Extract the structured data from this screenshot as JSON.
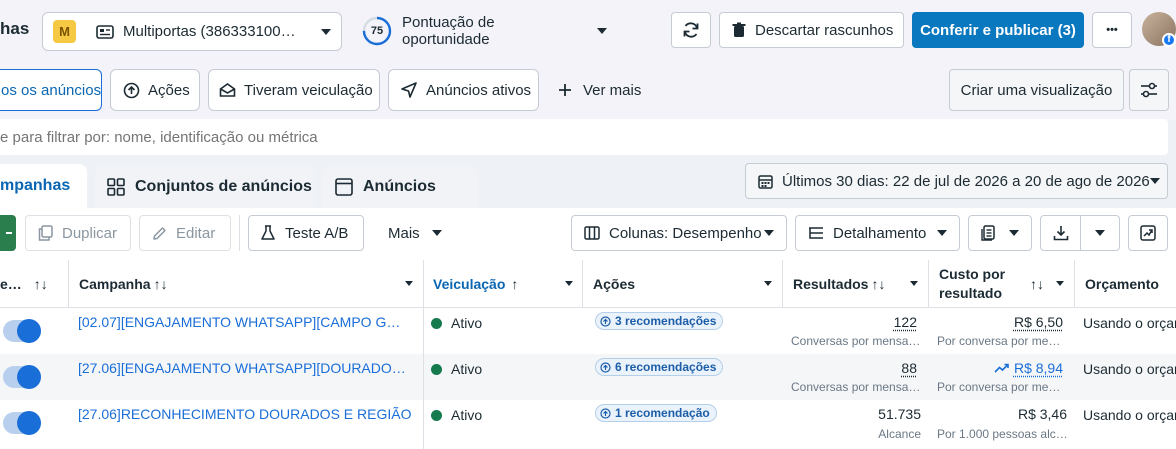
{
  "header": {
    "title_partial": "has",
    "account_badge": "M",
    "account_name": "Multiportas (386333100…",
    "opportunity_score": "75",
    "opportunity_label": "Pontuação de oportunidade",
    "discard_label": "Descartar rascunhos",
    "publish_label": "Conferir e publicar (3)",
    "more_label": "•••"
  },
  "filters": {
    "items": [
      {
        "label": "os os anúncios",
        "icon": "none"
      },
      {
        "label": "Ações",
        "icon": "arrow-up-circle-icon"
      },
      {
        "label": "Tiveram veiculação",
        "icon": "envelope-icon"
      },
      {
        "label": "Anúncios ativos",
        "icon": "send-icon"
      }
    ],
    "see_more": "Ver mais",
    "create_view": "Criar uma visualização"
  },
  "search": {
    "placeholder": "e para filtrar por: nome, identificação ou métrica"
  },
  "tabs": [
    {
      "label": "mpanhas",
      "active": true
    },
    {
      "label": "Conjuntos de anúncios",
      "active": false
    },
    {
      "label": "Anúncios",
      "active": false
    }
  ],
  "date_range": "Últimos 30 dias: 22 de jul de 2026 a 20 de ago de 2026",
  "toolbar": {
    "duplicate": "Duplicar",
    "edit": "Editar",
    "ab_test": "Teste A/B",
    "more": "Mais",
    "columns": "Colunas: Desempenho",
    "breakdown": "Detalhamento"
  },
  "columns": {
    "delivery_toggle": "e…",
    "campaign": "Campanha",
    "delivery": "Veiculação",
    "actions": "Ações",
    "results": "Resultados",
    "cost_per_result_1": "Custo por",
    "cost_per_result_2": "resultado",
    "budget": "Orçamento"
  },
  "rows": [
    {
      "name": "[02.07][ENGAJAMENTO WHATSAPP][CAMPO G…",
      "status": "Ativo",
      "actions": "3 recomendações",
      "result": "122",
      "result_sub": "Conversas por mensa…",
      "cost": "R$ 6,50",
      "cost_sub": "Por conversa por me…",
      "budget": "Usando o orçam"
    },
    {
      "name": "[27.06][ENGAJAMENTO WHATSAPP][DOURADO…",
      "status": "Ativo",
      "actions": "6 recomendações",
      "result": "88",
      "result_sub": "Conversas por mensa…",
      "cost": "R$ 8,94",
      "cost_sub": "Por conversa por me…",
      "budget": "Usando o orçam"
    },
    {
      "name": "[27.06]RECONHECIMENTO DOURADOS E REGIÃO",
      "status": "Ativo",
      "actions": "1 recomendação",
      "result": "51.735",
      "result_sub": "Alcance",
      "cost": "R$ 3,46",
      "cost_sub": "Por 1.000 pessoas alc…",
      "budget": "Usando o orçam"
    }
  ],
  "colors": {
    "accent": "#0a66b2",
    "primary_button": "#0a78be",
    "link": "#1a6ed8",
    "active_status": "#157a4e",
    "score_ring": "#1a6ed8"
  }
}
